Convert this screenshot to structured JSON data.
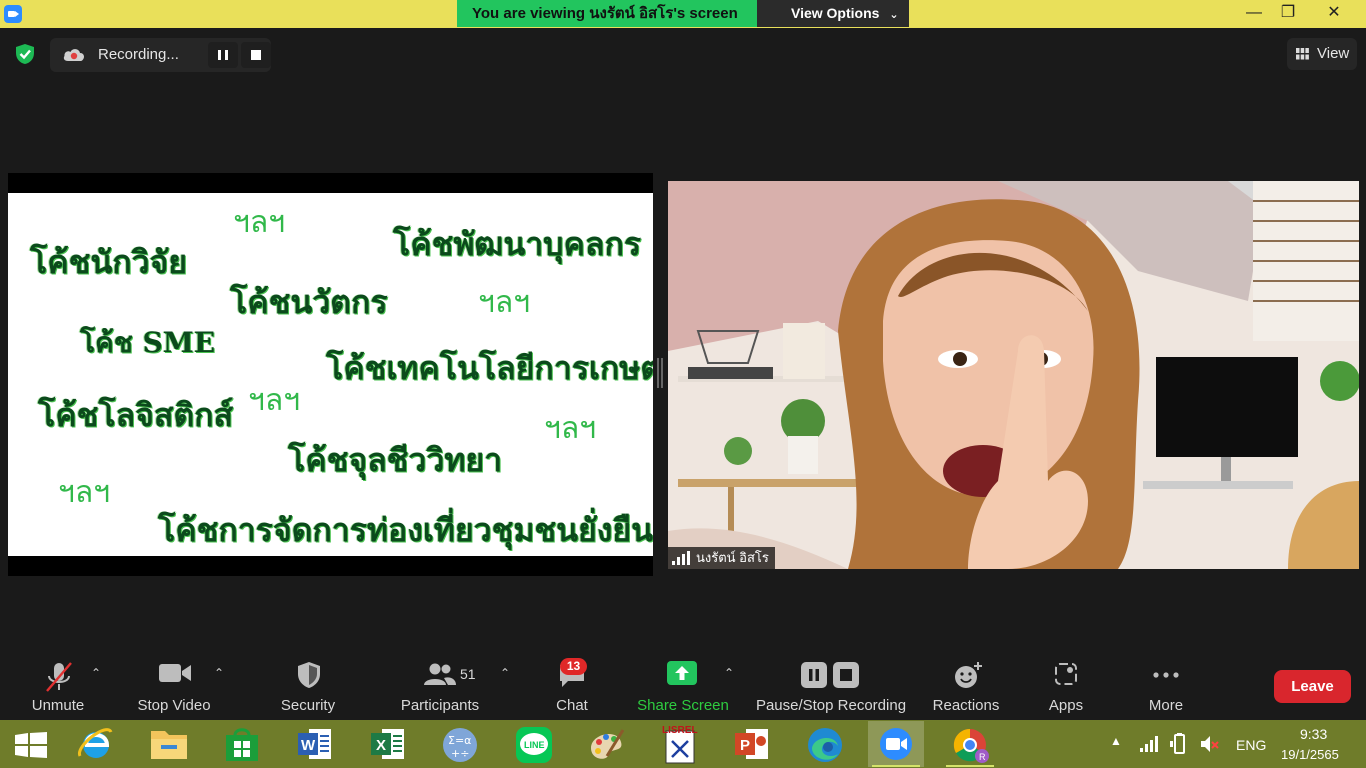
{
  "window": {
    "viewing_banner": "You are viewing นงรัตน์ อิสโร's screen",
    "view_options": "View Options",
    "controls": {
      "minimize": "—",
      "maximize": "❐",
      "close": "✕"
    }
  },
  "topbar": {
    "recording_label": "Recording...",
    "view_label": "View"
  },
  "slide": {
    "coaches": [
      "โค้ชนักวิจัย",
      "โค้ชพัฒนาบุคลกร",
      "โค้ชนวัตกร",
      "โค้ช SME",
      "โค้ชเทคโนโลยีการเกษตร",
      "โค้ชโลจิสติกส์",
      "โค้ชจุลชีววิทยา",
      "โค้ชการจัดการท่องเที่ยวชุมชนยั่งยืน"
    ],
    "etc_label": "ฯลฯ"
  },
  "video": {
    "participant_name": "นงรัตน์ อิสโร"
  },
  "toolbar": {
    "unmute": "Unmute",
    "stop_video": "Stop Video",
    "security": "Security",
    "participants": "Participants",
    "participants_count": "51",
    "chat": "Chat",
    "chat_badge": "13",
    "share_screen": "Share Screen",
    "pause_stop_recording": "Pause/Stop Recording",
    "reactions": "Reactions",
    "apps": "Apps",
    "more": "More",
    "leave": "Leave"
  },
  "taskbar": {
    "apps": [
      "windows-start",
      "internet-explorer",
      "file-explorer",
      "microsoft-store",
      "word",
      "excel",
      "calculator",
      "line",
      "paint",
      "lisrel",
      "powerpoint",
      "edge",
      "zoom",
      "chrome"
    ],
    "language": "ENG",
    "time": "9:33",
    "date": "19/1/2565"
  },
  "colors": {
    "banner_green": "#22c55e",
    "titlebar_yellow": "#e9e05a",
    "leave_red": "#d9262d",
    "share_green": "#22c55e",
    "taskbar_olive": "#6f7c2a"
  }
}
